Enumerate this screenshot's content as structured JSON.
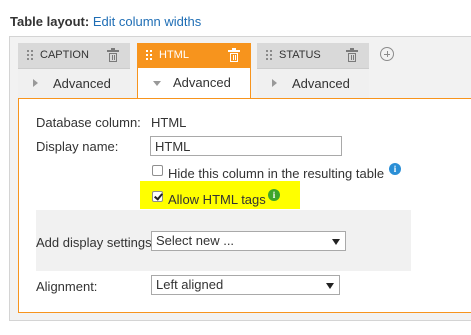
{
  "header": {
    "label": "Table layout:",
    "link": "Edit column widths"
  },
  "columns": [
    {
      "title": "CAPTION",
      "advanced_label": "Advanced",
      "active": false
    },
    {
      "title": "HTML",
      "advanced_label": "Advanced",
      "active": true
    },
    {
      "title": "STATUS",
      "advanced_label": "Advanced",
      "active": false
    }
  ],
  "settings": {
    "database_column_label": "Database column:",
    "database_column_value": "HTML",
    "display_name_label": "Display name:",
    "display_name_value": "HTML",
    "hide_column_label": "Hide this column in the resulting table",
    "hide_column_checked": false,
    "allow_html_label": "Allow HTML tags",
    "allow_html_checked": true,
    "add_display_settings_label": "Add display settings:",
    "add_display_settings_value": "Select new ...",
    "alignment_label": "Alignment:",
    "alignment_value": "Left aligned"
  },
  "colors": {
    "active_tab": "#f7941d",
    "link": "#1f6eb5",
    "highlight": "#ffff00",
    "info_blue": "#2b8fd6",
    "info_green": "#3da52a"
  },
  "icons": {
    "info": "i",
    "add_column": "plus-circle-icon",
    "delete": "trash-icon",
    "drag": "drag-handle-icon"
  }
}
